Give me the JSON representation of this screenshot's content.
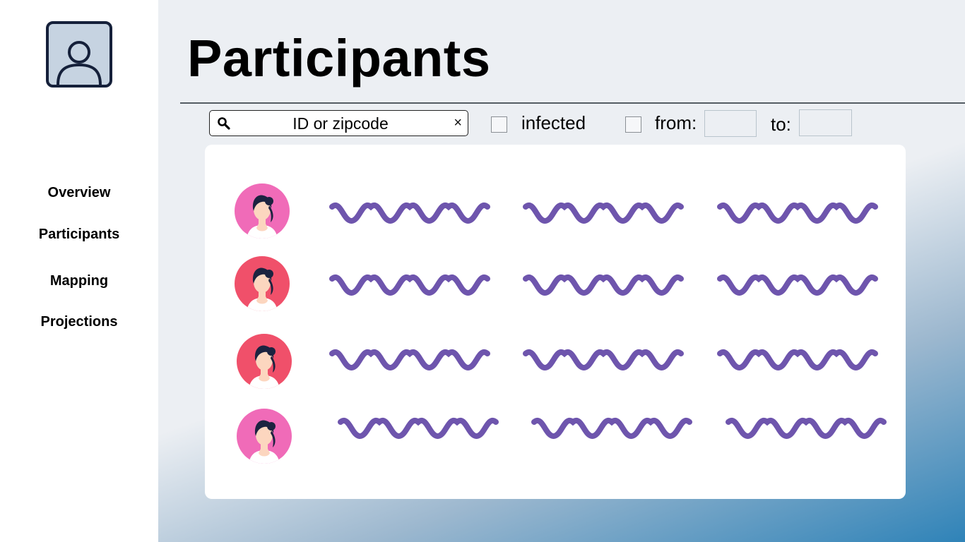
{
  "sidebar": {
    "profile_icon": "user-profile-icon",
    "items": [
      {
        "label": "Overview"
      },
      {
        "label": "Participants"
      },
      {
        "label": "Mapping"
      },
      {
        "label": "Projections"
      }
    ]
  },
  "header": {
    "title": "Participants"
  },
  "filters": {
    "search_placeholder": "ID or zipcode",
    "search_value": "",
    "clear_symbol": "×",
    "infected_label": "infected",
    "infected_checked": false,
    "from_label": "from:",
    "from_checked": false,
    "from_value": "",
    "to_label": "to:",
    "to_value": ""
  },
  "participants": [
    {
      "avatar": "female-avatar-icon",
      "avatar_color": "#f06bb8",
      "fields": [
        "placeholder-text",
        "placeholder-text",
        "placeholder-text"
      ]
    },
    {
      "avatar": "female-avatar-icon",
      "avatar_color": "#f0506a",
      "fields": [
        "placeholder-text",
        "placeholder-text",
        "placeholder-text"
      ]
    },
    {
      "avatar": "female-avatar-icon",
      "avatar_color": "#f0506a",
      "fields": [
        "placeholder-text",
        "placeholder-text",
        "placeholder-text"
      ]
    },
    {
      "avatar": "female-avatar-icon",
      "avatar_color": "#f06bb8",
      "fields": [
        "placeholder-text",
        "placeholder-text",
        "placeholder-text"
      ]
    }
  ],
  "colors": {
    "accent_purple": "#6e55ad",
    "navy": "#1c2340",
    "skin": "#fcd6bf"
  }
}
